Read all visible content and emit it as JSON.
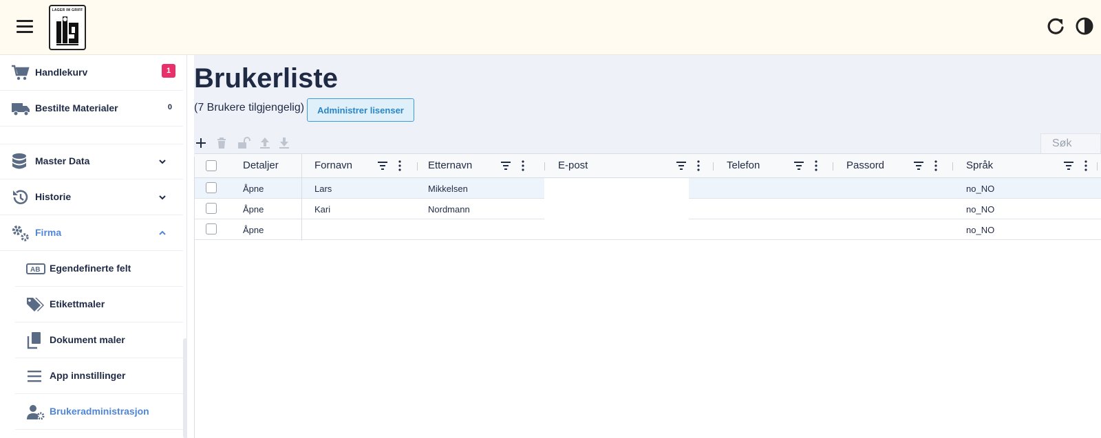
{
  "header": {
    "logo_text": "LAGER IM GRIFF",
    "icons": [
      "menu-icon",
      "refresh-icon",
      "contrast-icon"
    ]
  },
  "sidebar": {
    "items": [
      {
        "label": "Handlekurv",
        "icon": "cart-icon",
        "badge": "1"
      },
      {
        "label": "Bestilte Materialer",
        "icon": "truck-icon",
        "badge": "0"
      },
      {
        "label": "Master Data",
        "icon": "database-icon"
      },
      {
        "label": "Historie",
        "icon": "history-icon"
      },
      {
        "label": "Firma",
        "icon": "gears-icon",
        "expanded": true
      }
    ],
    "subitems": [
      {
        "label": "Egendefinerte felt",
        "icon": "ab-field-icon"
      },
      {
        "label": "Etikettmaler",
        "icon": "tags-icon"
      },
      {
        "label": "Dokument maler",
        "icon": "documents-icon"
      },
      {
        "label": "App innstillinger",
        "icon": "list-icon"
      },
      {
        "label": "Brukeradministrasjon",
        "icon": "user-gear-icon",
        "active": true
      }
    ],
    "active_color": "#4f86d9"
  },
  "main": {
    "title": "Brukerliste",
    "subtitle": "(7 Brukere tilgjengelig)",
    "admin_button": "Administrer lisenser",
    "search_placeholder": "Søk",
    "columns": [
      "Detaljer",
      "Fornavn",
      "Etternavn",
      "E-post",
      "Telefon",
      "Passord",
      "Språk"
    ],
    "rows": [
      {
        "detaljer": "Åpne",
        "fornavn": "Lars",
        "etternavn": "Mikkelsen",
        "epost": "",
        "telefon": "",
        "passord": "",
        "sprak": "no_NO"
      },
      {
        "detaljer": "Åpne",
        "fornavn": "Kari",
        "etternavn": "Nordmann",
        "epost": "",
        "telefon": "",
        "passord": "",
        "sprak": "no_NO"
      },
      {
        "detaljer": "Åpne",
        "fornavn": "",
        "etternavn": "",
        "epost": "",
        "telefon": "",
        "passord": "",
        "sprak": "no_NO"
      }
    ]
  },
  "colors": {
    "topbar_bg": "#fffbf0",
    "header_bg": "#eef1f8",
    "badge_red": "#e8306a",
    "button_blue": "#2a85c4"
  }
}
